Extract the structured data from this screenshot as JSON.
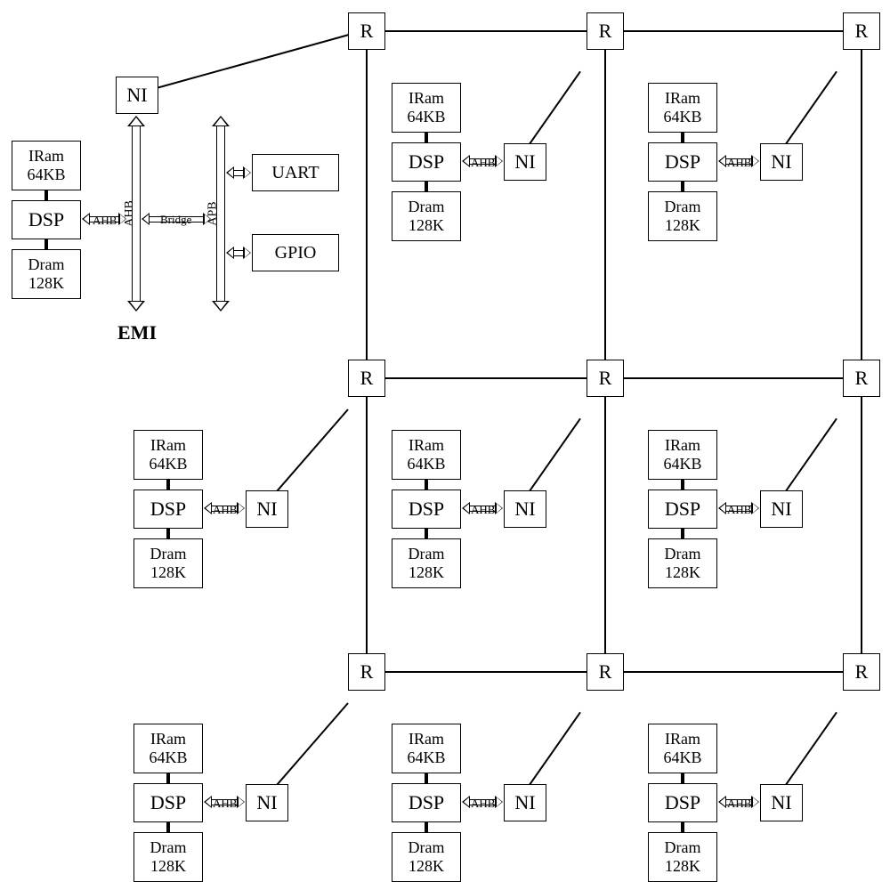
{
  "labels": {
    "router": "R",
    "ni": "NI",
    "dsp": "DSP",
    "iram_l1": "IRam",
    "iram_l2": "64KB",
    "dram_l1": "Dram",
    "dram_l2": "128K",
    "ahb": "AHB",
    "ahb_bus": "AHB",
    "apb_bus": "APB",
    "bridge": "Bridge",
    "uart": "UART",
    "gpio": "GPIO",
    "emi": "EMI"
  },
  "grid": {
    "cols": [
      412,
      680,
      968
    ],
    "rows": [
      35,
      425,
      755
    ],
    "router_size": 42
  }
}
